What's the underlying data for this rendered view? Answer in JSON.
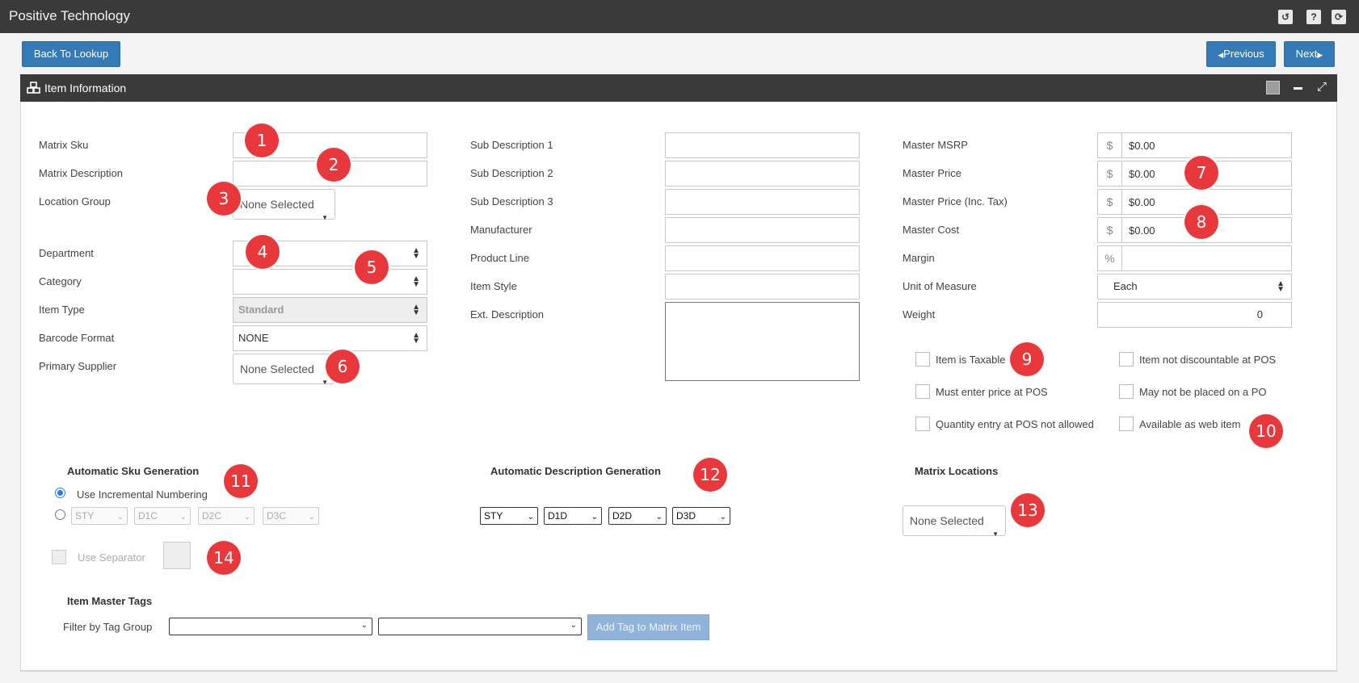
{
  "app": {
    "title": "Positive Technology"
  },
  "toolbar": {
    "back_label": "Back To Lookup",
    "prev_label": "Previous",
    "next_label": "Next"
  },
  "panel": {
    "title": "Item Information"
  },
  "left_fields": {
    "matrix_sku": "Matrix Sku",
    "matrix_description": "Matrix Description",
    "location_group": "Location Group",
    "location_group_value": "None Selected",
    "department": "Department",
    "category": "Category",
    "item_type": "Item Type",
    "item_type_value": "Standard",
    "barcode_format": "Barcode Format",
    "barcode_format_value": "NONE",
    "primary_supplier": "Primary Supplier",
    "primary_supplier_value": "None Selected"
  },
  "mid_fields": {
    "sub1": "Sub Description 1",
    "sub2": "Sub Description 2",
    "sub3": "Sub Description 3",
    "manufacturer": "Manufacturer",
    "product_line": "Product Line",
    "item_style": "Item Style",
    "ext_description": "Ext. Description"
  },
  "right_fields": {
    "msrp": "Master MSRP",
    "msrp_value": "$0.00",
    "price": "Master Price",
    "price_value": "$0.00",
    "price_tax": "Master Price (Inc. Tax)",
    "price_tax_value": "$0.00",
    "cost": "Master Cost",
    "cost_value": "$0.00",
    "margin": "Margin",
    "margin_value": "",
    "uom": "Unit of Measure",
    "uom_value": "Each",
    "weight": "Weight",
    "weight_value": "0",
    "dollar_symbol": "$",
    "percent_symbol": "%"
  },
  "checkboxes": {
    "taxable": "Item is Taxable",
    "not_discountable": "Item not discountable at POS",
    "enter_price": "Must enter price at POS",
    "no_po": "May not be placed on a PO",
    "no_qty": "Quantity entry at POS not allowed",
    "web_item": "Available as web item"
  },
  "sku_gen": {
    "title": "Automatic Sku Generation",
    "incremental": "Use Incremental Numbering",
    "parts": [
      "STY",
      "D1C",
      "D2C",
      "D3C"
    ],
    "separator": "Use Separator"
  },
  "desc_gen": {
    "title": "Automatic Description Generation",
    "parts": [
      "STY",
      "D1D",
      "D2D",
      "D3D"
    ]
  },
  "locations": {
    "title": "Matrix Locations",
    "value": "None Selected"
  },
  "tags": {
    "title": "Item Master Tags",
    "filter_label": "Filter by Tag Group",
    "add_label": "Add Tag to Matrix Item"
  },
  "badges": [
    "1",
    "2",
    "3",
    "4",
    "5",
    "6",
    "7",
    "8",
    "9",
    "10",
    "11",
    "12",
    "13",
    "14"
  ],
  "colors": {
    "header": "#3a3a3a",
    "button": "#337ab7",
    "badge": "#e8383b"
  }
}
